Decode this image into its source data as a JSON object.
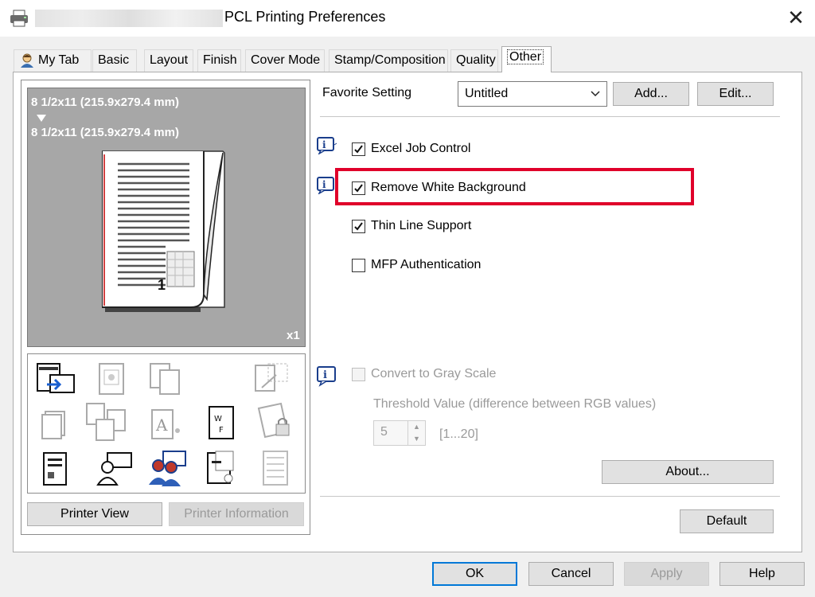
{
  "window": {
    "title": "PCL Printing Preferences",
    "close_glyph": "✕"
  },
  "tabs": [
    {
      "label": "My Tab"
    },
    {
      "label": "Basic"
    },
    {
      "label": "Layout"
    },
    {
      "label": "Finish"
    },
    {
      "label": "Cover Mode"
    },
    {
      "label": "Stamp/Composition"
    },
    {
      "label": "Quality"
    },
    {
      "label": "Other"
    }
  ],
  "preview": {
    "original_size": "8 1/2x11 (215.9x279.4 mm)",
    "output_size": "8 1/2x11 (215.9x279.4 mm)",
    "page_number": "1",
    "copies": "x1"
  },
  "left_buttons": {
    "printer_view": "Printer View",
    "printer_information": "Printer Information"
  },
  "favorite": {
    "label": "Favorite Setting",
    "value": "Untitled",
    "add": "Add...",
    "edit": "Edit..."
  },
  "options": {
    "excel_job_control": {
      "label": "Excel Job Control",
      "checked": true
    },
    "remove_white_background": {
      "label": "Remove White Background",
      "checked": true
    },
    "thin_line_support": {
      "label": "Thin Line Support",
      "checked": true
    },
    "mfp_authentication": {
      "label": "MFP Authentication",
      "checked": false
    },
    "convert_gray_scale": {
      "label": "Convert to Gray Scale",
      "checked": false,
      "enabled": false
    }
  },
  "threshold": {
    "label": "Threshold Value (difference between RGB values)",
    "value": "5",
    "range": "[1...20]"
  },
  "about": "About...",
  "default": "Default",
  "footer": {
    "ok": "OK",
    "cancel": "Cancel",
    "apply": "Apply",
    "help": "Help"
  },
  "colors": {
    "highlight": "#e0002a",
    "focus": "#0078d7",
    "preview_bg": "#a7a7a7"
  }
}
